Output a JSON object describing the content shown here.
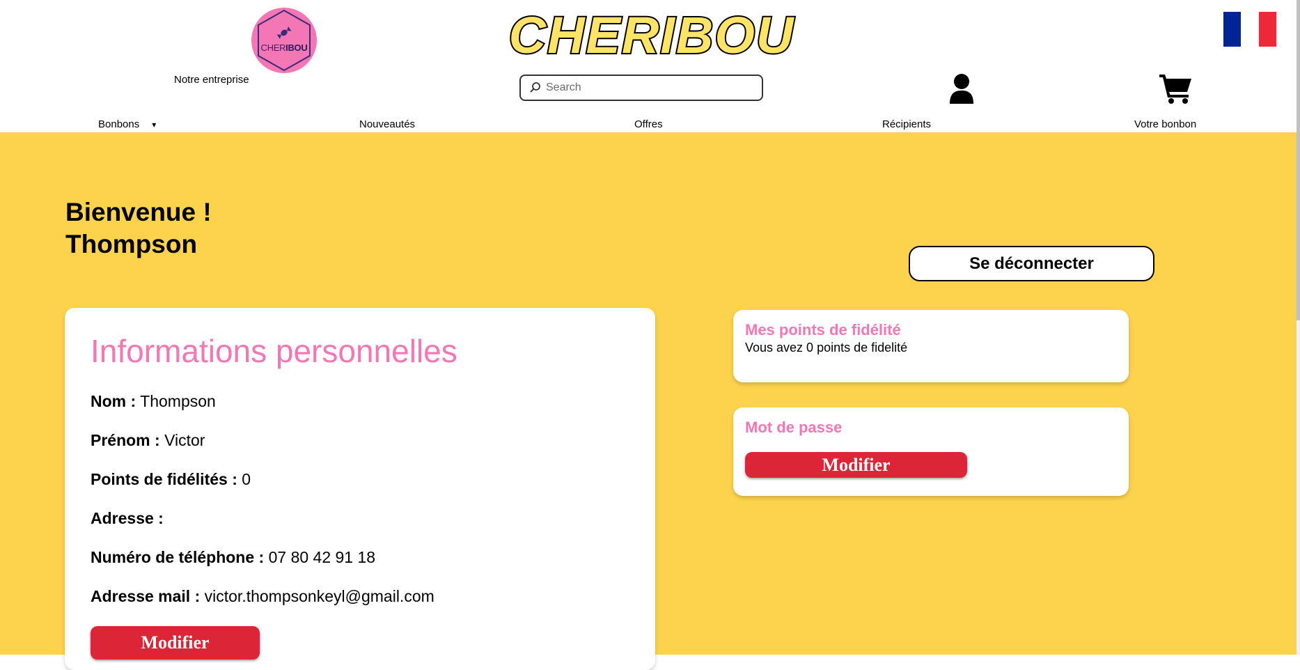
{
  "header": {
    "logo": {
      "text_part1": "CHER",
      "text_part2": "IBOU"
    },
    "company_link": "Notre entreprise",
    "brand_title": "CHERIBOU",
    "search": {
      "placeholder": "Search",
      "value": ""
    },
    "icons": {
      "user": "user-icon",
      "cart": "cart-icon",
      "flag": "french-flag-icon"
    },
    "flag_colors": [
      "#002395",
      "#ffffff",
      "#ed2939"
    ]
  },
  "nav": {
    "items": [
      {
        "label": "Bonbons",
        "has_dropdown": true,
        "arrow": "▾"
      },
      {
        "label": "Nouveautés"
      },
      {
        "label": "Offres"
      },
      {
        "label": "Récipients"
      },
      {
        "label": "Votre bonbon"
      }
    ]
  },
  "main": {
    "welcome_line1": "Bienvenue !",
    "welcome_line2": "Thompson",
    "logout_label": "Se déconnecter",
    "personal_info": {
      "title": "Informations personnelles",
      "fields": [
        {
          "label": "Nom :",
          "value": "Thompson"
        },
        {
          "label": "Prénom :",
          "value": "Victor"
        },
        {
          "label": "Points de fidélités :",
          "value": "0"
        },
        {
          "label": "Adresse :",
          "value": ""
        },
        {
          "label": "Numéro de téléphone :",
          "value": "07 80 42 91 18"
        },
        {
          "label": "Adresse mail :",
          "value": "victor.thompsonkeyl@gmail.com"
        }
      ],
      "edit_label": "Modifier"
    },
    "loyalty": {
      "title": "Mes points de fidélité",
      "text": "Vous avez 0 points de fidelité"
    },
    "password": {
      "title": "Mot de passe",
      "edit_label": "Modifier"
    }
  },
  "colors": {
    "background_yellow": "#fdd34d",
    "accent_pink": "#f277b4",
    "button_red": "#dc2637",
    "brand_title_fill": "#fde466"
  }
}
